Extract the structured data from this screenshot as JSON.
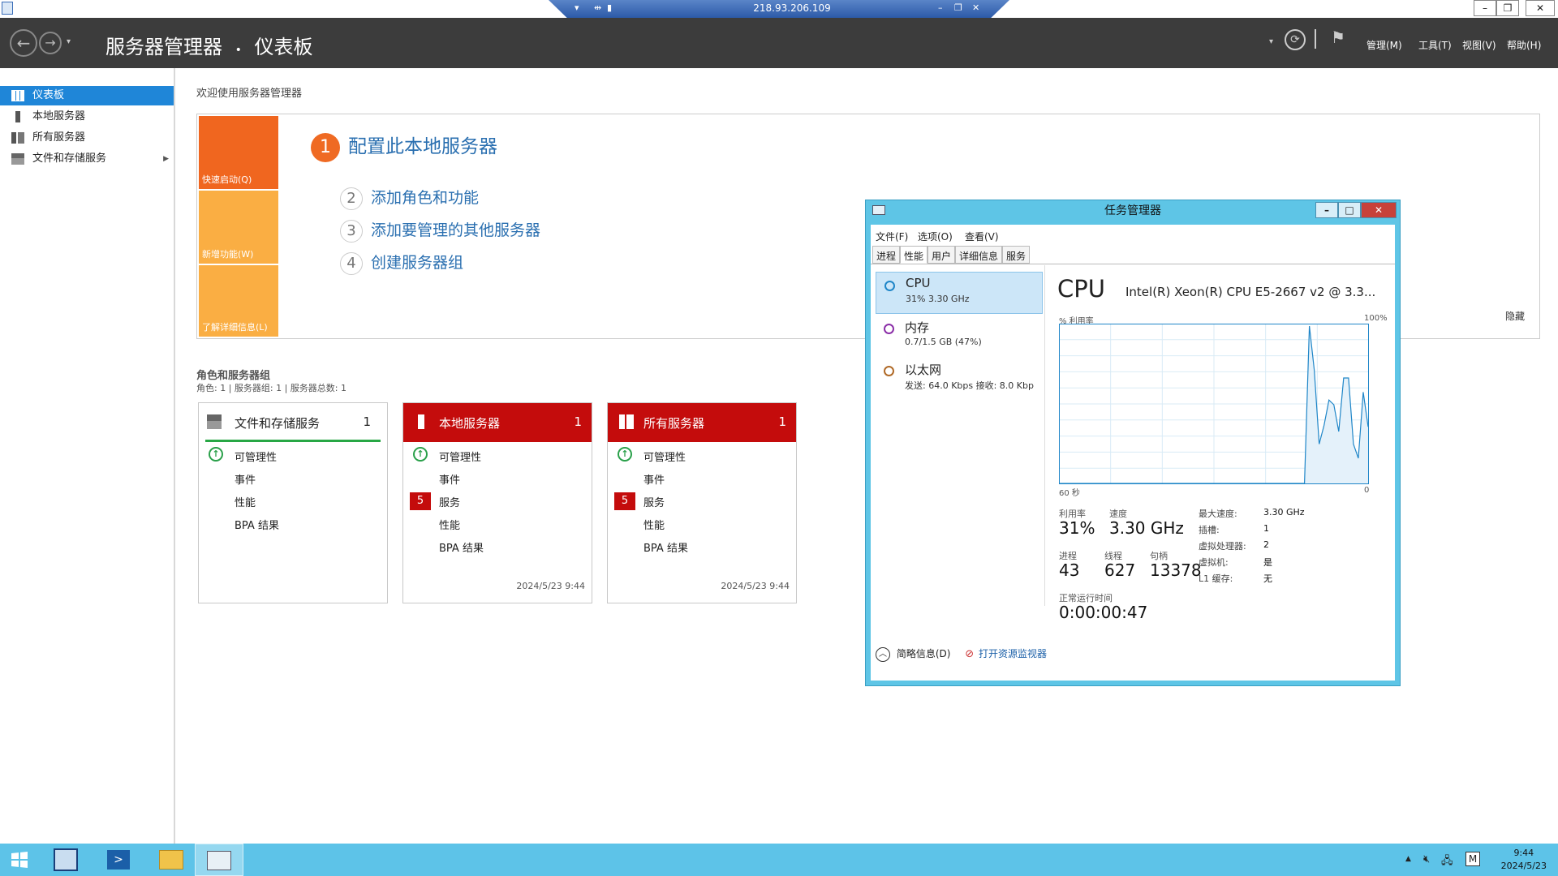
{
  "rdp": {
    "address": "218.93.206.109"
  },
  "header": {
    "breadcrumb_root": "服务器管理器",
    "breadcrumb_separator": "•",
    "breadcrumb_page": "仪表板",
    "menus": [
      "管理(M)",
      "工具(T)",
      "视图(V)",
      "帮助(H)"
    ]
  },
  "sidebar": {
    "items": [
      {
        "label": "仪表板",
        "icon": "dashboard-icon",
        "active": true
      },
      {
        "label": "本地服务器",
        "icon": "server-icon"
      },
      {
        "label": "所有服务器",
        "icon": "servers-icon"
      },
      {
        "label": "文件和存储服务",
        "icon": "storage-icon",
        "has_children": true
      }
    ]
  },
  "welcome": {
    "title": "欢迎使用服务器管理器",
    "tiles": [
      "快速启动(Q)",
      "新增功能(W)",
      "了解详细信息(L)"
    ],
    "tile_colors": [
      "#f0661f",
      "#faae43",
      "#faae43"
    ],
    "steps": [
      {
        "num": "1",
        "label": "配置此本地服务器"
      },
      {
        "num": "2",
        "label": "添加角色和功能"
      },
      {
        "num": "3",
        "label": "添加要管理的其他服务器"
      },
      {
        "num": "4",
        "label": "创建服务器组"
      }
    ],
    "hide": "隐藏"
  },
  "roles": {
    "title": "角色和服务器组",
    "subtitle": "角色: 1 | 服务器组: 1 | 服务器总数: 1",
    "cards": [
      {
        "title": "文件和存储服务",
        "count": "1",
        "rows": [
          "可管理性",
          "事件",
          "性能",
          "BPA 结果"
        ],
        "timestamp": ""
      },
      {
        "title": "本地服务器",
        "count": "1",
        "rows": [
          "可管理性",
          "事件",
          "服务",
          "性能",
          "BPA 结果"
        ],
        "badge": "5",
        "timestamp": "2024/5/23 9:44"
      },
      {
        "title": "所有服务器",
        "count": "1",
        "rows": [
          "可管理性",
          "事件",
          "服务",
          "性能",
          "BPA 结果"
        ],
        "badge": "5",
        "timestamp": "2024/5/23 9:44"
      }
    ]
  },
  "taskmgr": {
    "title": "任务管理器",
    "menu": [
      "文件(F)",
      "选项(O)",
      "查看(V)"
    ],
    "tabs": [
      "进程",
      "性能",
      "用户",
      "详细信息",
      "服务"
    ],
    "resources": [
      {
        "name": "CPU",
        "value": "31% 3.30 GHz",
        "color": "#1f86c8"
      },
      {
        "name": "内存",
        "value": "0.7/1.5 GB (47%)",
        "color": "#8b2fa8"
      },
      {
        "name": "以太网",
        "value": "发送: 64.0 Kbps 接收: 8.0 Kbp",
        "color": "#b06a28"
      }
    ],
    "cpu_heading": "CPU",
    "cpu_model": "Intel(R) Xeon(R) CPU E5-2667 v2 @ 3.3...",
    "graph_ylabel": "% 利用率",
    "graph_ymax": "100%",
    "graph_xstart": "60 秒",
    "graph_xend": "0",
    "graph_series": [
      0,
      0,
      0,
      0,
      0,
      0,
      0,
      0,
      0,
      0,
      0,
      0,
      0,
      0,
      0,
      0,
      0,
      0,
      0,
      0,
      0,
      0,
      0,
      0,
      0,
      0,
      0,
      0,
      0,
      0,
      0,
      0,
      0,
      0,
      0,
      0,
      0,
      0,
      0,
      0,
      0,
      0,
      0,
      0,
      0,
      0,
      0,
      0,
      0,
      0,
      0,
      100,
      72,
      25,
      37,
      53,
      50,
      33,
      67,
      67,
      25,
      16,
      58,
      36
    ],
    "stats": {
      "util_label": "利用率",
      "util_value": "31%",
      "speed_label": "速度",
      "speed_value": "3.30 GHz",
      "proc_label": "进程",
      "proc_value": "43",
      "thread_label": "线程",
      "thread_value": "627",
      "handle_label": "句柄",
      "handle_value": "13378",
      "uptime_label": "正常运行时间",
      "uptime_value": "0:00:00:47"
    },
    "details": [
      {
        "label": "最大速度:",
        "value": "3.30 GHz"
      },
      {
        "label": "插槽:",
        "value": "1"
      },
      {
        "label": "虚拟处理器:",
        "value": "2"
      },
      {
        "label": "虚拟机:",
        "value": "是"
      },
      {
        "label": "L1 缓存:",
        "value": "无"
      }
    ],
    "footer_brief": "简略信息(D)",
    "footer_monitor": "打开资源监视器"
  },
  "taskbar": {
    "time": "9:44",
    "date": "2024/5/23"
  },
  "colors": {
    "header": "#3c3c3c",
    "accent": "#1f86d8",
    "alert_red": "#c40c0c",
    "ok_green": "#28a745"
  }
}
